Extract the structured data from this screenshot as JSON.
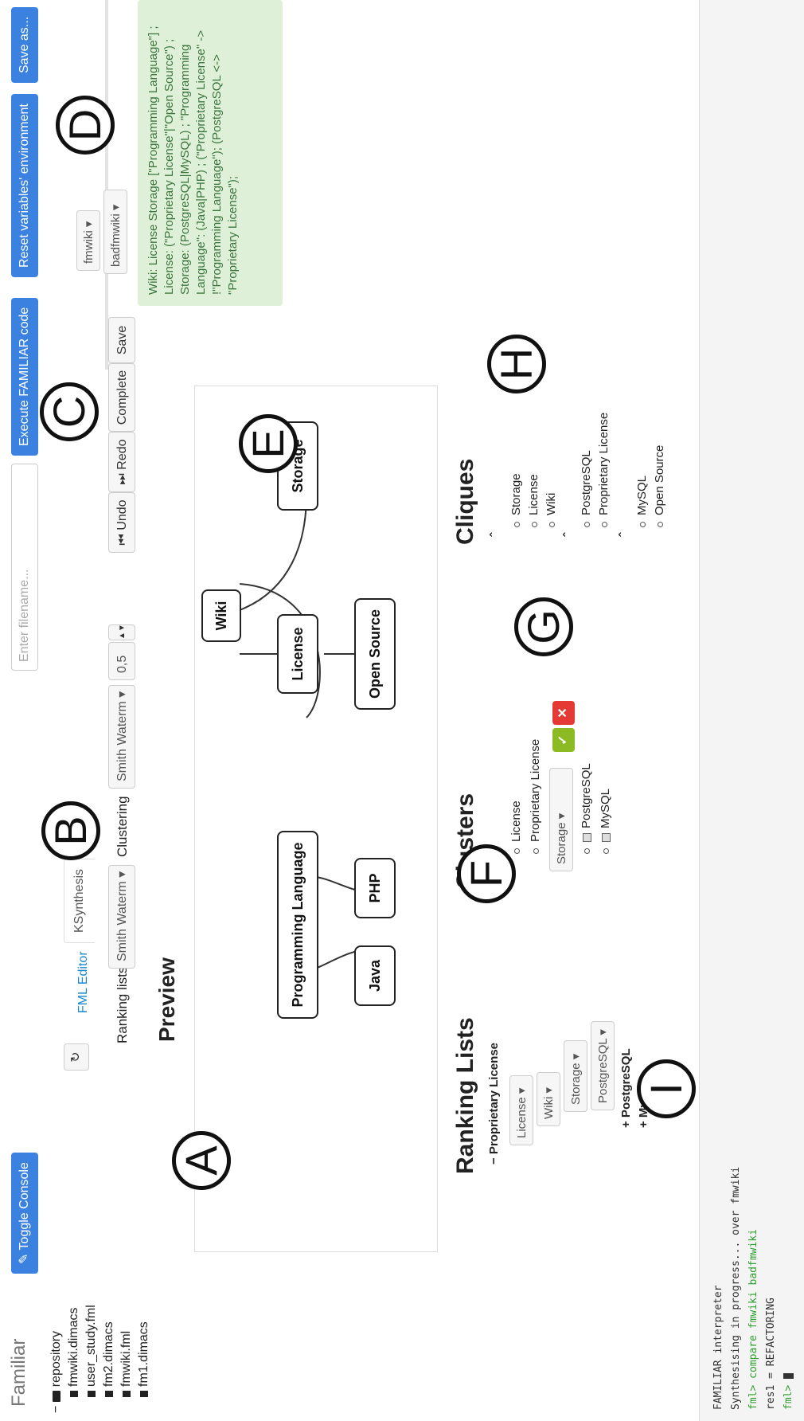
{
  "app": {
    "brand": "Familiar"
  },
  "topbar": {
    "toggle_console": "Toggle Console",
    "filename_placeholder": "Enter filename...",
    "execute": "Execute FAMILIAR code",
    "reset": "Reset variables' environment",
    "save_as": "Save as..."
  },
  "tree": {
    "root": "repository",
    "files": [
      "fmwiki.dimacs",
      "user_study.fml",
      "fm2.dimacs",
      "fmwiki.fml",
      "fm1.dimacs"
    ]
  },
  "tabs": {
    "fml_editor": "FML Editor",
    "ksynthesis": "KSynthesis"
  },
  "controls": {
    "ranking_label": "Ranking lists",
    "ranking_value": "Smith Waterm",
    "clustering_label": "Clustering",
    "clustering_value": "Smith Waterm",
    "threshold": "0,5",
    "undo": "Undo",
    "redo": "Redo",
    "complete": "Complete",
    "save": "Save"
  },
  "preview": {
    "title": "Preview",
    "nodes": {
      "wiki": "Wiki",
      "programming_language": "Programming Language",
      "license": "License",
      "storage": "Storage",
      "java": "Java",
      "php": "PHP",
      "open_source": "Open Source"
    }
  },
  "ranking_lists": {
    "title": "Ranking Lists",
    "header": "Proprietary License",
    "selects": [
      "License",
      "Wiki",
      "Storage",
      "PostgreSQL"
    ],
    "collapsed": [
      "PostgreSQL",
      "MySQL"
    ]
  },
  "clusters": {
    "title": "Clusters",
    "items": [
      "License",
      "Proprietary License"
    ],
    "select": "Storage",
    "checked": [
      "PostgreSQL",
      "MySQL"
    ]
  },
  "cliques": {
    "title": "Cliques",
    "group1": [
      "Storage",
      "License",
      "Wiki"
    ],
    "group2": [
      "PostgreSQL",
      "Proprietary License"
    ],
    "group3": [
      "MySQL",
      "Open Source"
    ]
  },
  "variables": {
    "var1": "fmwiki",
    "var2": "badfmwiki"
  },
  "info": {
    "text": "Wiki: License Storage [\"Programming Language\"] ; License: (\"Proprietary License\"|\"Open Source\") ; Storage: (PostgreSQL|MySQL) ; \"Programming Language\": (Java|PHP) ; (\"Proprietary License\" -> !\"Programming Language\"); (PostgreSQL <-> \"Proprietary License\");"
  },
  "console": {
    "lines": [
      "FAMILIAR interpreter",
      "Synthesising in progress... over fmwiki",
      "fml> compare fmwiki badfmwiki",
      "res1 = REFACTORING",
      "fml> "
    ],
    "highlight_color": "#2e9e2e"
  },
  "annotations": [
    "A",
    "B",
    "C",
    "D",
    "E",
    "F",
    "G",
    "H",
    "I"
  ]
}
